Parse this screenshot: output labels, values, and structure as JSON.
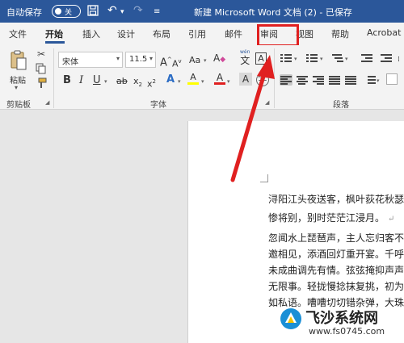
{
  "titlebar": {
    "autosave_label": "自动保存",
    "autosave_state": "关",
    "doc_title": "新建 Microsoft Word 文档 (2) - 已保存",
    "icons": [
      "save-icon",
      "undo-icon",
      "redo-icon"
    ]
  },
  "tabs": {
    "items": [
      "文件",
      "开始",
      "插入",
      "设计",
      "布局",
      "引用",
      "邮件",
      "审阅",
      "视图",
      "帮助",
      "Acrobat"
    ],
    "active": "开始",
    "highlighted": "审阅"
  },
  "ribbon": {
    "clipboard": {
      "paste_label": "粘贴",
      "group_label": "剪贴板"
    },
    "font": {
      "font_name": "宋体",
      "font_size": "11.5",
      "grow": "A",
      "shrink": "A",
      "aa_label": "Aa",
      "phonetic_top": "wén",
      "phonetic_main": "文",
      "char_border": "A",
      "bold": "B",
      "italic": "I",
      "underline": "U",
      "strike": "ab",
      "sub": "x",
      "sub_index": "2",
      "sup": "x",
      "sup_index": "2",
      "effect": "A",
      "font_color": "A",
      "highlight_color": "A",
      "group_label": "字体"
    },
    "paragraph": {
      "group_label": "段落"
    },
    "colors": {
      "accent": "#2b579a",
      "highlight_box": "#e02020",
      "font_color_bar": "#e02020",
      "highlight_bar": "#ffff00"
    }
  },
  "document": {
    "lines": [
      "浔阳江头夜送客，枫叶荻花秋瑟",
      "惨将别，别时茫茫江浸月。",
      "忽闻水上琵琶声，主人忘归客不",
      "邀相见，添酒回灯重开宴。千呼",
      "未成曲调先有情。弦弦掩抑声声",
      "无限事。轻拢慢捻抹复挑，初为",
      "如私语。嘈嘈切切错杂弹，大珠"
    ],
    "paragraph_mark": "↵"
  },
  "watermark": {
    "name": "飞沙系统网",
    "url": "www.fs0745.com"
  }
}
